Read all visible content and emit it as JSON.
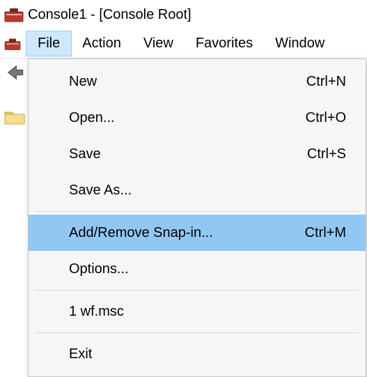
{
  "window": {
    "title": "Console1 - [Console Root]"
  },
  "menubar": {
    "file": "File",
    "action": "Action",
    "view": "View",
    "favorites": "Favorites",
    "window": "Window"
  },
  "file_menu": {
    "new": {
      "label": "New",
      "shortcut": "Ctrl+N"
    },
    "open": {
      "label": "Open...",
      "shortcut": "Ctrl+O"
    },
    "save": {
      "label": "Save",
      "shortcut": "Ctrl+S"
    },
    "save_as": {
      "label": "Save As..."
    },
    "add_remove": {
      "label": "Add/Remove Snap-in...",
      "shortcut": "Ctrl+M"
    },
    "options": {
      "label": "Options..."
    },
    "recent1": {
      "label": "1 wf.msc"
    },
    "exit": {
      "label": "Exit"
    }
  }
}
